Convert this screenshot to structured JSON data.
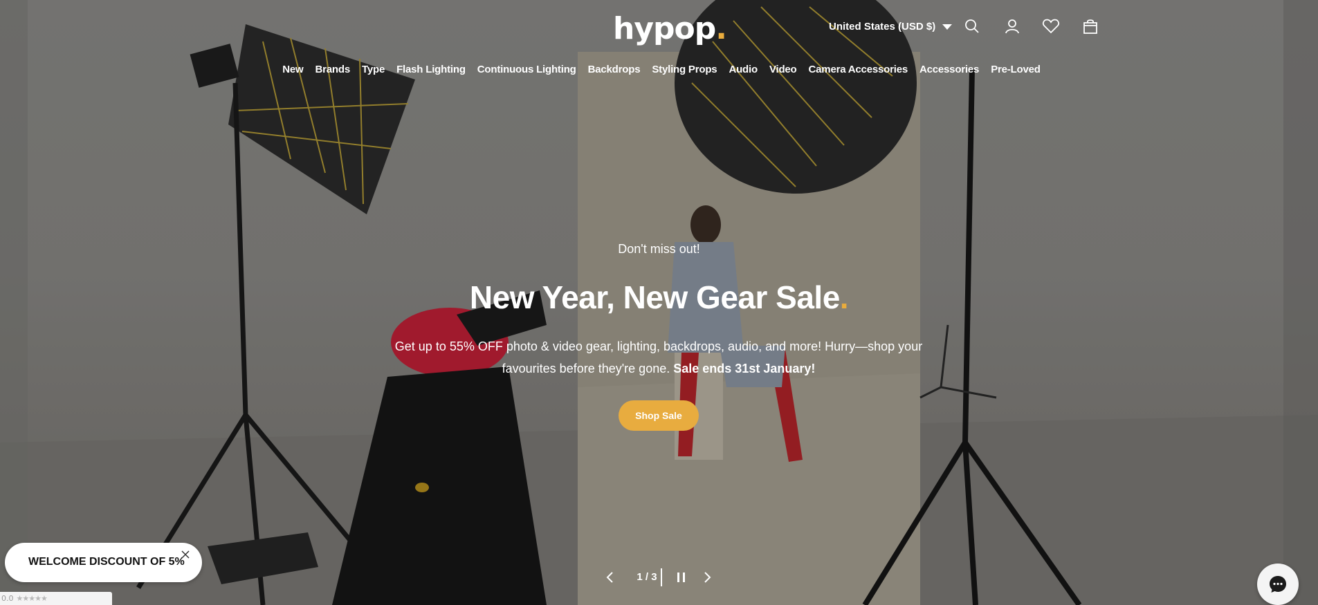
{
  "header": {
    "logo_text": "hypop",
    "logo_dot": ".",
    "currency_label": "United States (USD $)",
    "icons": [
      "search-icon",
      "account-icon",
      "wishlist-heart-icon",
      "cart-bag-icon"
    ]
  },
  "nav": {
    "items": [
      "New",
      "Brands",
      "Type",
      "Flash Lighting",
      "Continuous Lighting",
      "Backdrops",
      "Styling Props",
      "Audio",
      "Video",
      "Camera Accessories",
      "Accessories",
      "Pre-Loved"
    ]
  },
  "hero": {
    "eyebrow": "Don't miss out!",
    "title": "New Year, New Gear Sale",
    "title_dot": ".",
    "text_part1": "Get up to 55% OFF photo & video gear, lighting, backdrops, audio, and more! Hurry—shop your favourites before they're gone.",
    "text_bold": "Sale ends 31st January!",
    "cta_label": "Shop Sale"
  },
  "slider": {
    "current": "1",
    "total": "3",
    "counter_text": "1 / 3"
  },
  "popup": {
    "welcome_label": "WELCOME DISCOUNT OF 5%"
  },
  "rating_badge": {
    "score": "0.0",
    "stars": "★★★★★"
  },
  "colors": {
    "accent": "#e8ac3f",
    "text": "#ffffff",
    "popup_bg": "#ffffff"
  }
}
